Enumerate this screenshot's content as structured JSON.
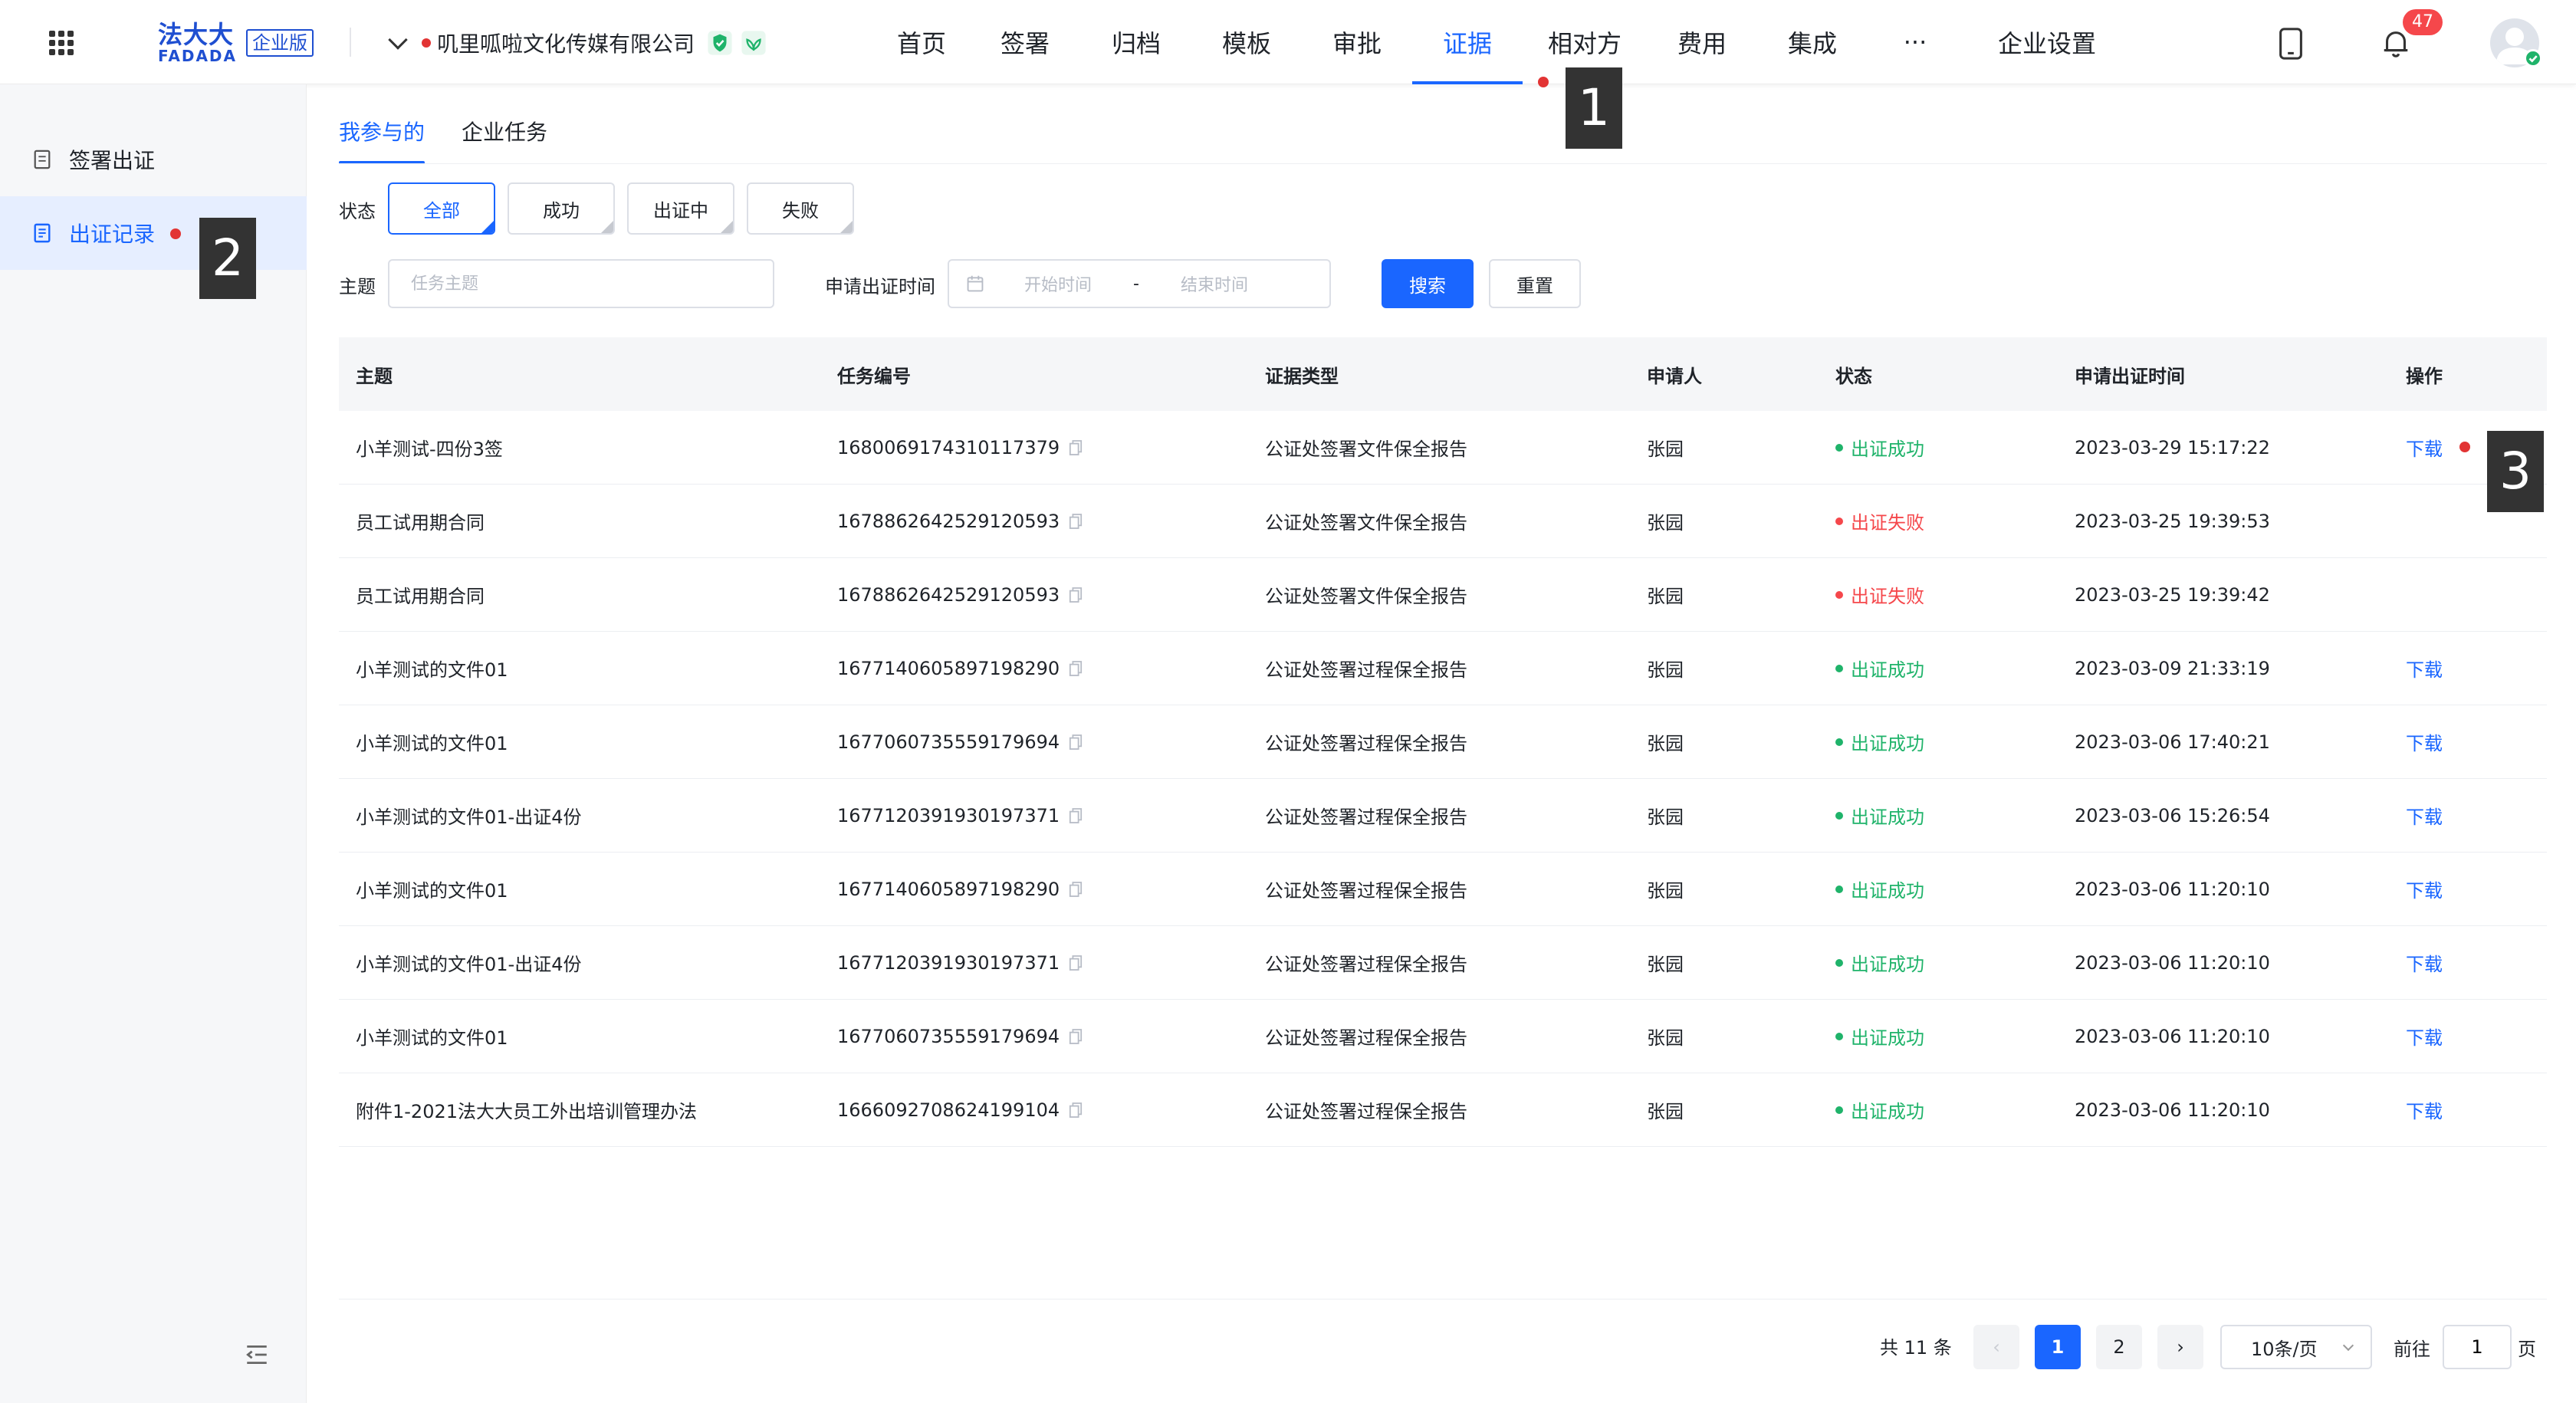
{
  "header": {
    "logo_cn": "法大大",
    "logo_en": "FADADA",
    "edition": "企业版",
    "company": "叽里呱啦文化传媒有限公司",
    "nav": [
      "首页",
      "签署",
      "归档",
      "模板",
      "审批",
      "证据",
      "相对方",
      "费用",
      "集成",
      "···",
      "企业设置"
    ],
    "active_nav": "证据",
    "notification_count": "47"
  },
  "annotations": [
    "1",
    "2",
    "3"
  ],
  "sidebar": {
    "items": [
      {
        "label": "签署出证",
        "icon": "document-icon"
      },
      {
        "label": "出证记录",
        "icon": "record-list-icon"
      }
    ]
  },
  "tabs": [
    "我参与的",
    "企业任务"
  ],
  "filters": {
    "status_label": "状态",
    "status_options": [
      "全部",
      "成功",
      "出证中",
      "失败"
    ],
    "subject_label": "主题",
    "subject_placeholder": "任务主题",
    "time_label": "申请出证时间",
    "start_placeholder": "开始时间",
    "range_sep": "-",
    "end_placeholder": "结束时间",
    "search_btn": "搜索",
    "reset_btn": "重置"
  },
  "table": {
    "columns": [
      "主题",
      "任务编号",
      "证据类型",
      "申请人",
      "状态",
      "申请出证时间",
      "操作"
    ],
    "rows": [
      {
        "subject": "小羊测试-四份3签",
        "id": "1680069174310117379",
        "type": "公证处签署文件保全报告",
        "applicant": "张园",
        "status": "出证成功",
        "status_color": "#1fb36a",
        "time": "2023-03-29 15:17:22",
        "action": "下载"
      },
      {
        "subject": "员工试用期合同",
        "id": "1678862642529120593",
        "type": "公证处签署文件保全报告",
        "applicant": "张园",
        "status": "出证失败",
        "status_color": "#f5474b",
        "time": "2023-03-25 19:39:53",
        "action": ""
      },
      {
        "subject": "员工试用期合同",
        "id": "1678862642529120593",
        "type": "公证处签署文件保全报告",
        "applicant": "张园",
        "status": "出证失败",
        "status_color": "#f5474b",
        "time": "2023-03-25 19:39:42",
        "action": ""
      },
      {
        "subject": "小羊测试的文件01",
        "id": "1677140605897198290",
        "type": "公证处签署过程保全报告",
        "applicant": "张园",
        "status": "出证成功",
        "status_color": "#1fb36a",
        "time": "2023-03-09 21:33:19",
        "action": "下载"
      },
      {
        "subject": "小羊测试的文件01",
        "id": "1677060735559179694",
        "type": "公证处签署过程保全报告",
        "applicant": "张园",
        "status": "出证成功",
        "status_color": "#1fb36a",
        "time": "2023-03-06 17:40:21",
        "action": "下载"
      },
      {
        "subject": "小羊测试的文件01-出证4份",
        "id": "1677120391930197371",
        "type": "公证处签署过程保全报告",
        "applicant": "张园",
        "status": "出证成功",
        "status_color": "#1fb36a",
        "time": "2023-03-06 15:26:54",
        "action": "下载"
      },
      {
        "subject": "小羊测试的文件01",
        "id": "1677140605897198290",
        "type": "公证处签署过程保全报告",
        "applicant": "张园",
        "status": "出证成功",
        "status_color": "#1fb36a",
        "time": "2023-03-06 11:20:10",
        "action": "下载"
      },
      {
        "subject": "小羊测试的文件01-出证4份",
        "id": "1677120391930197371",
        "type": "公证处签署过程保全报告",
        "applicant": "张园",
        "status": "出证成功",
        "status_color": "#1fb36a",
        "time": "2023-03-06 11:20:10",
        "action": "下载"
      },
      {
        "subject": "小羊测试的文件01",
        "id": "1677060735559179694",
        "type": "公证处签署过程保全报告",
        "applicant": "张园",
        "status": "出证成功",
        "status_color": "#1fb36a",
        "time": "2023-03-06 11:20:10",
        "action": "下载"
      },
      {
        "subject": "附件1-2021法大大员工外出培训管理办法",
        "id": "1666092708624199104",
        "type": "公证处签署过程保全报告",
        "applicant": "张园",
        "status": "出证成功",
        "status_color": "#1fb36a",
        "time": "2023-03-06 11:20:10",
        "action": "下载"
      }
    ]
  },
  "pagination": {
    "total": "共 11 条",
    "pages": [
      "1",
      "2"
    ],
    "current": "1",
    "prev": "‹",
    "next": "›",
    "page_size": "10条/页",
    "goto_label": "前往",
    "goto_value": "1",
    "goto_suffix": "页"
  },
  "colors": {
    "accent": "#1a66ff",
    "success": "#1fb36a",
    "error": "#f5474b"
  }
}
